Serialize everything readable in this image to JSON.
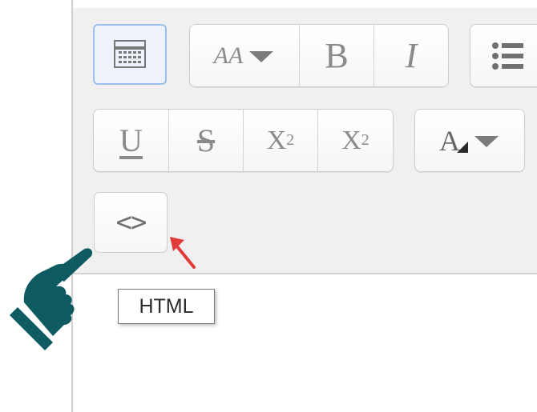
{
  "toolbar": {
    "toggle_icon": "toolbar-toggle-icon",
    "font_size_label": "AA",
    "bold_label": "B",
    "italic_label": "I",
    "list_icon": "unordered-list-icon",
    "underline_label": "U",
    "strike_label": "S",
    "subscript_base": "X",
    "subscript_index": "2",
    "superscript_base": "X",
    "superscript_index": "2",
    "font_color_label": "A",
    "html_label": "<>",
    "html_tooltip": "HTML"
  },
  "colors": {
    "toolbar_bg": "#f0f0f0",
    "toggle_border": "#9cc0ec",
    "arrow": "#e23b3b",
    "hand": "#0d5a60"
  }
}
